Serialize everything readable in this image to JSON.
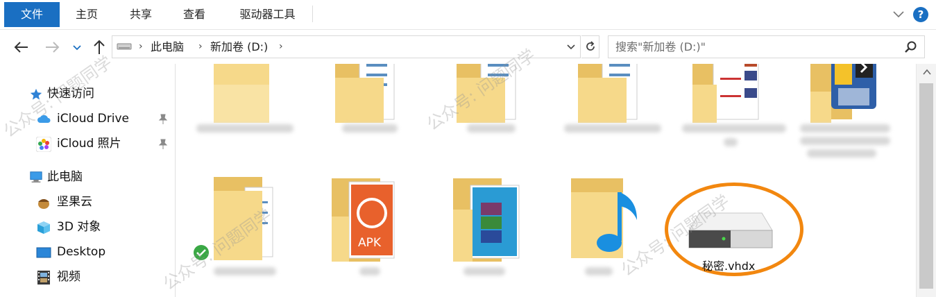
{
  "ribbon": {
    "tabs": [
      "文件",
      "主页",
      "共享",
      "查看",
      "驱动器工具"
    ],
    "help": "?"
  },
  "address": {
    "crumbs": [
      "此电脑",
      "新加卷 (D:)"
    ]
  },
  "search": {
    "placeholder": "搜索\"新加卷 (D:)\""
  },
  "nav": {
    "quick_access": "快速访问",
    "icloud_drive": "iCloud Drive",
    "icloud_photos": "iCloud 照片",
    "this_pc": "此电脑",
    "jianguoyun": "坚果云",
    "objects3d": "3D 对象",
    "desktop": "Desktop",
    "videos": "视频"
  },
  "files": {
    "vhdx": "秘密.vhdx",
    "apk_badge": "APK"
  },
  "watermark": {
    "text": "公众号: 问题同学"
  },
  "colors": {
    "accent": "#1a6fc2",
    "highlight": "#f2870f",
    "folder": "#f5d77c"
  }
}
